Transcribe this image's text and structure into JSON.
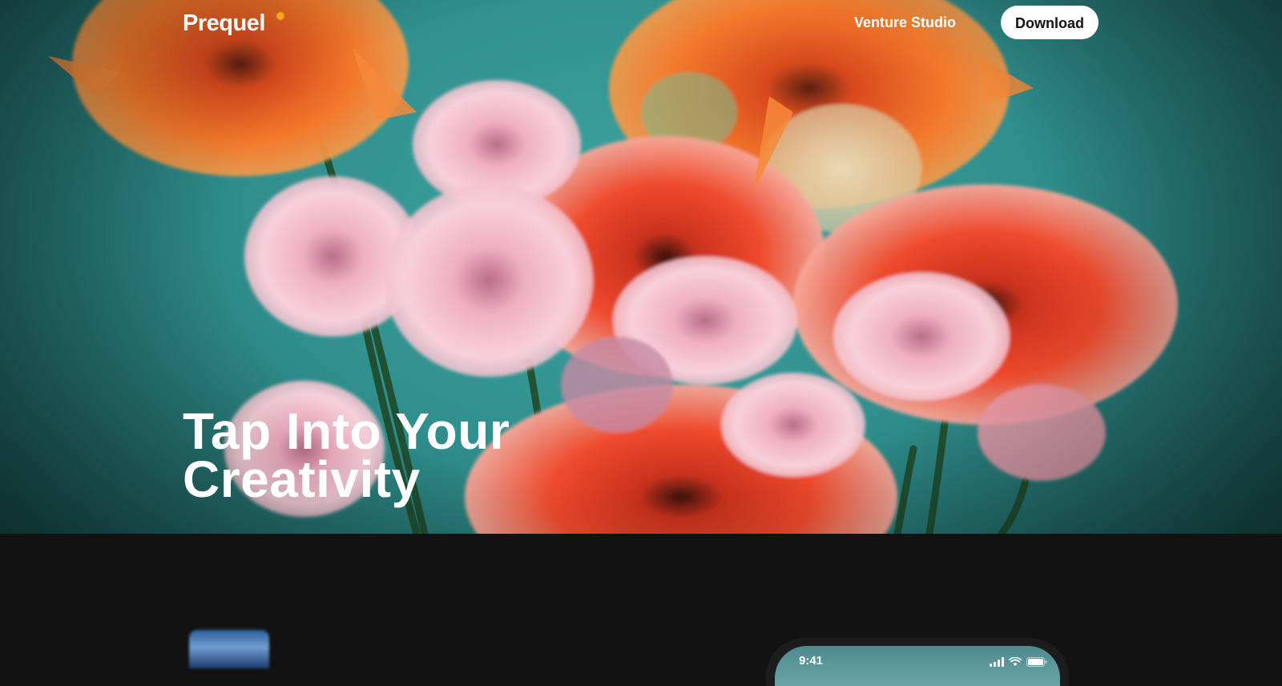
{
  "nav": {
    "logo_text": "Prequel",
    "venture_studio_label": "Venture Studio",
    "download_label": "Download"
  },
  "hero": {
    "headline_line1": "Tap Into Your",
    "headline_line2": "Creativity",
    "accent_color": "#f6a31c",
    "background_color": "#3fa3a0"
  },
  "phone": {
    "time": "9:41",
    "icons": [
      "signal-icon",
      "wifi-icon",
      "battery-icon"
    ]
  }
}
